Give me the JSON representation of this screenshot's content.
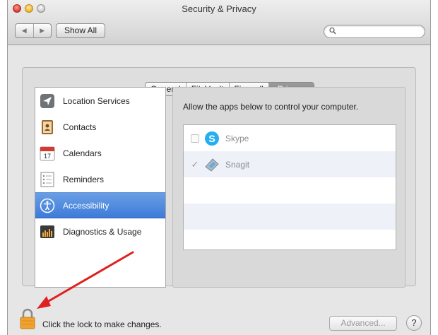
{
  "window": {
    "title": "Security & Privacy"
  },
  "toolbar": {
    "back_label": "◀",
    "forward_label": "▶",
    "show_all_label": "Show All",
    "search_placeholder": ""
  },
  "tabs": [
    {
      "label": "General",
      "active": false
    },
    {
      "label": "FileVault",
      "active": false
    },
    {
      "label": "Firewall",
      "active": false
    },
    {
      "label": "Privacy",
      "active": true
    }
  ],
  "sidebar": {
    "items": [
      {
        "label": "Location Services",
        "icon": "location-arrow-icon",
        "selected": false
      },
      {
        "label": "Contacts",
        "icon": "contacts-book-icon",
        "selected": false
      },
      {
        "label": "Calendars",
        "icon": "calendar-icon",
        "selected": false,
        "icon_text": "17"
      },
      {
        "label": "Reminders",
        "icon": "reminders-list-icon",
        "selected": false
      },
      {
        "label": "Accessibility",
        "icon": "accessibility-icon",
        "selected": true
      },
      {
        "label": "Diagnostics & Usage",
        "icon": "diagnostics-icon",
        "selected": false
      }
    ]
  },
  "privacy_panel": {
    "description": "Allow the apps below to control your computer.",
    "apps": [
      {
        "name": "Skype",
        "checked": false,
        "icon": "skype-icon"
      },
      {
        "name": "Snagit",
        "checked": true,
        "icon": "snagit-icon"
      }
    ]
  },
  "footer": {
    "lock_text": "Click the lock to make changes.",
    "advanced_label": "Advanced...",
    "help_label": "?"
  },
  "colors": {
    "selection": "#3d7bd9",
    "annotation_arrow": "#e02020"
  }
}
